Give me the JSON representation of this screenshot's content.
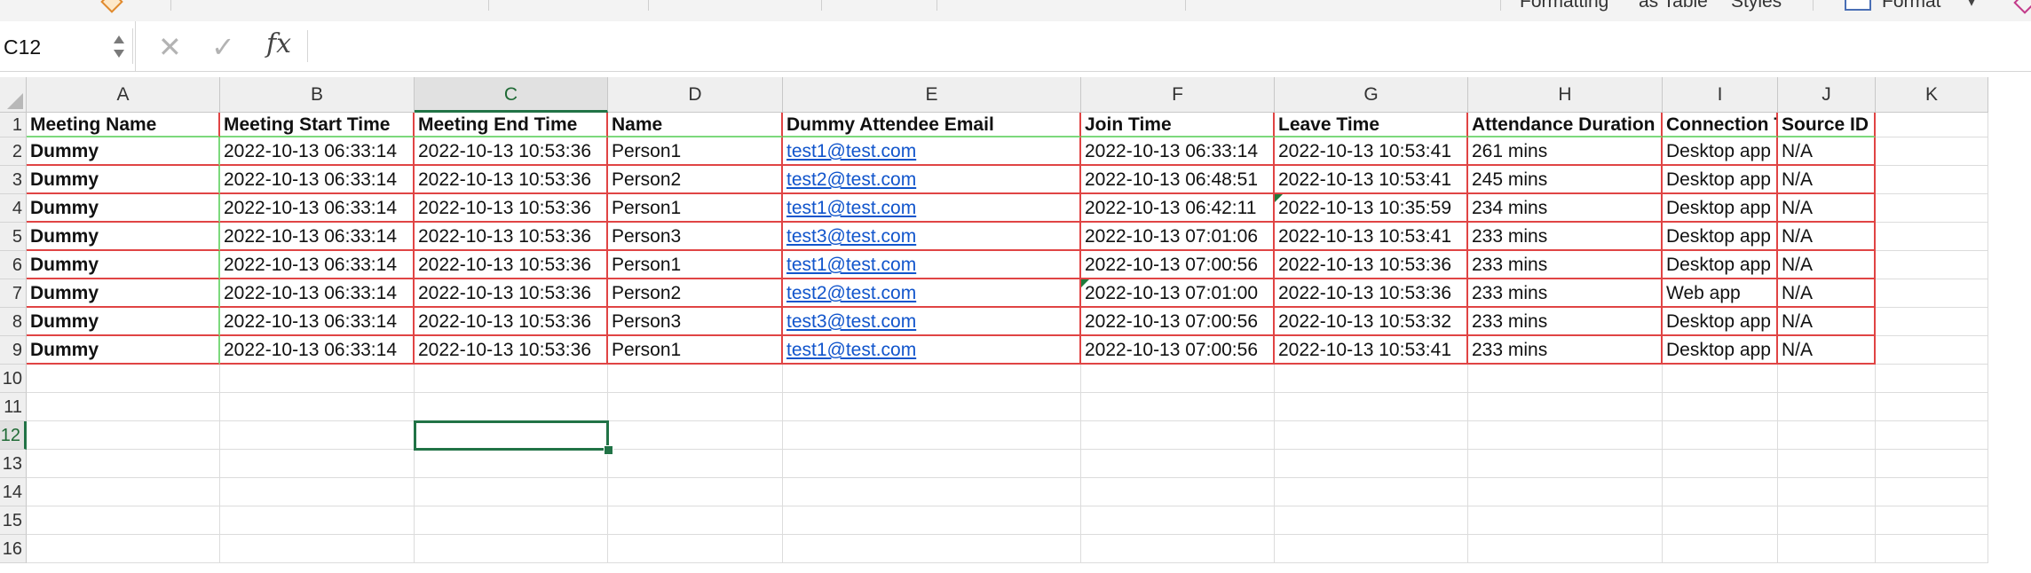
{
  "ribbon": {
    "labels": [
      "Formatting",
      "as Table",
      "Styles",
      "Format"
    ]
  },
  "formula_bar": {
    "name_box": "C12",
    "cancel_icon": "close-icon",
    "enter_icon": "check-icon",
    "fx_label": "fx",
    "value": ""
  },
  "sheet": {
    "columns": [
      "A",
      "B",
      "C",
      "D",
      "E",
      "F",
      "G",
      "H",
      "I",
      "J",
      "K"
    ],
    "selected_column": "C",
    "row_numbers": [
      "1",
      "2",
      "3",
      "4",
      "5",
      "6",
      "7",
      "8",
      "9",
      "10",
      "11",
      "12",
      "13",
      "14",
      "15",
      "16"
    ],
    "selected_row": "12",
    "active_cell": "C12",
    "headers": [
      "Meeting Name",
      "Meeting Start Time",
      "Meeting End Time",
      "Name",
      "Dummy Attendee Email",
      "Join Time",
      "Leave Time",
      "Attendance Duration",
      "Connection T",
      "Source ID"
    ],
    "rows": [
      [
        "Dummy",
        "2022-10-13 06:33:14",
        "2022-10-13 10:53:36",
        "Person1",
        "test1@test.com",
        "2022-10-13 06:33:14",
        "2022-10-13 10:53:41",
        "261 mins",
        "Desktop app",
        "N/A"
      ],
      [
        "Dummy",
        "2022-10-13 06:33:14",
        "2022-10-13 10:53:36",
        "Person2",
        "test2@test.com",
        "2022-10-13 06:48:51",
        "2022-10-13 10:53:41",
        "245 mins",
        "Desktop app",
        "N/A"
      ],
      [
        "Dummy",
        "2022-10-13 06:33:14",
        "2022-10-13 10:53:36",
        "Person1",
        "test1@test.com",
        "2022-10-13 06:42:11",
        "2022-10-13 10:35:59",
        "234 mins",
        "Desktop app",
        "N/A"
      ],
      [
        "Dummy",
        "2022-10-13 06:33:14",
        "2022-10-13 10:53:36",
        "Person3",
        "test3@test.com",
        "2022-10-13 07:01:06",
        "2022-10-13 10:53:41",
        "233 mins",
        "Desktop app",
        "N/A"
      ],
      [
        "Dummy",
        "2022-10-13 06:33:14",
        "2022-10-13 10:53:36",
        "Person1",
        "test1@test.com",
        "2022-10-13 07:00:56",
        "2022-10-13 10:53:36",
        "233 mins",
        "Desktop app",
        "N/A"
      ],
      [
        "Dummy",
        "2022-10-13 06:33:14",
        "2022-10-13 10:53:36",
        "Person2",
        "test2@test.com",
        "2022-10-13 07:01:00",
        "2022-10-13 10:53:36",
        "233 mins",
        "Web app",
        "N/A"
      ],
      [
        "Dummy",
        "2022-10-13 06:33:14",
        "2022-10-13 10:53:36",
        "Person3",
        "test3@test.com",
        "2022-10-13 07:00:56",
        "2022-10-13 10:53:32",
        "233 mins",
        "Desktop app",
        "N/A"
      ],
      [
        "Dummy",
        "2022-10-13 06:33:14",
        "2022-10-13 10:53:36",
        "Person1",
        "test1@test.com",
        "2022-10-13 07:00:56",
        "2022-10-13 10:53:41",
        "233 mins",
        "Desktop app",
        "N/A"
      ]
    ]
  },
  "colors": {
    "accent_green": "#217346",
    "border_red": "#e04444",
    "border_green": "#7cd97c",
    "link_blue": "#1155cc"
  }
}
